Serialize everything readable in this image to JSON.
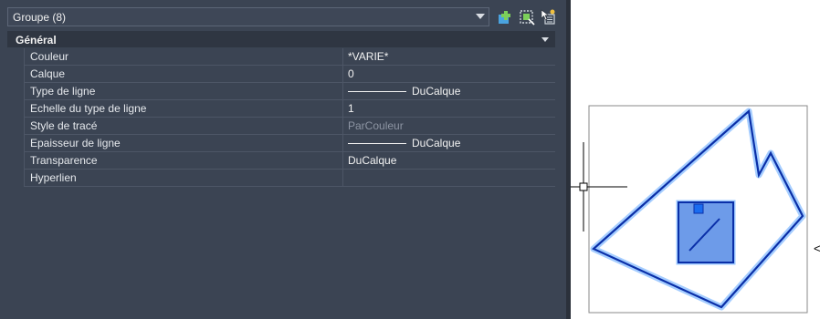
{
  "selector": {
    "value": "Groupe (8)"
  },
  "toolbar": {
    "icons": [
      "quick-select-icon",
      "select-objects-icon",
      "toggle-pickadd-icon"
    ]
  },
  "section": {
    "title": "Général"
  },
  "properties": [
    {
      "label": "Couleur",
      "value": "*VARIE*",
      "line": false,
      "muted": false
    },
    {
      "label": "Calque",
      "value": "0",
      "line": false,
      "muted": false
    },
    {
      "label": "Type de ligne",
      "value": "DuCalque",
      "line": true,
      "muted": false
    },
    {
      "label": "Echelle du type de ligne",
      "value": "1",
      "line": false,
      "muted": false
    },
    {
      "label": "Style de tracé",
      "value": "ParCouleur",
      "line": false,
      "muted": true
    },
    {
      "label": "Epaisseur de ligne",
      "value": "DuCalque",
      "line": true,
      "muted": false
    },
    {
      "label": "Transparence",
      "value": "DuCalque",
      "line": false,
      "muted": false
    },
    {
      "label": "Hyperlien",
      "value": "",
      "line": false,
      "muted": false
    }
  ],
  "colors": {
    "panel": "#3b4453",
    "selection_stroke": "#0a2fa8",
    "selection_fill": "#5c8fe6",
    "highlight_glow": "#6aa7ff"
  },
  "canvas": {
    "cursor_arrow": "<"
  }
}
